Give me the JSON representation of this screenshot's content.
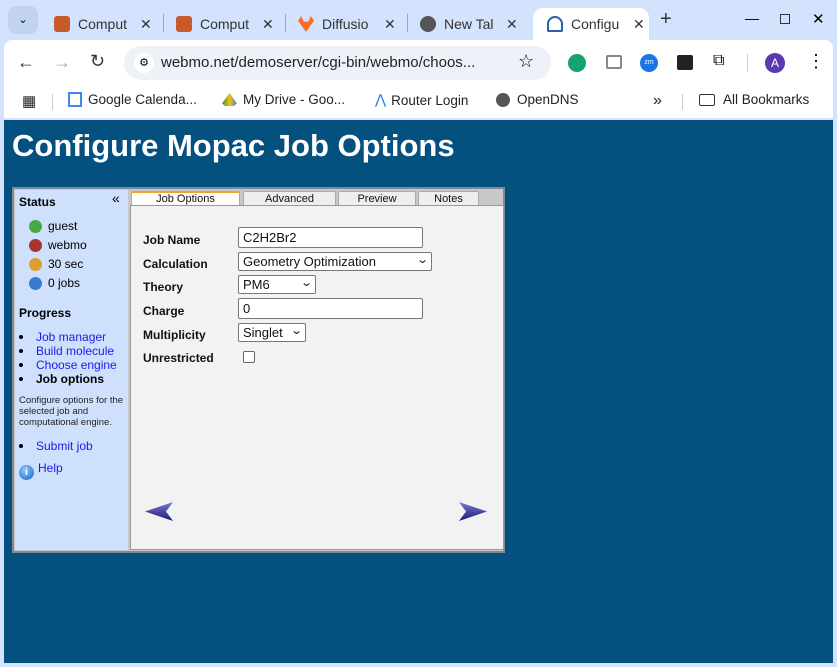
{
  "browser": {
    "tabs": [
      {
        "title": "Comput",
        "icon": "webmo-icon",
        "active": false
      },
      {
        "title": "Comput",
        "icon": "webmo-icon",
        "active": false
      },
      {
        "title": "Diffusio",
        "icon": "gitlab-icon",
        "active": false
      },
      {
        "title": "New Tal",
        "icon": "globe-icon",
        "active": false
      },
      {
        "title": "Configu",
        "icon": "webmo-logo-icon",
        "active": true
      }
    ],
    "url": "webmo.net/demoserver/cgi-bin/webmo/choos...",
    "profile_initial": "A",
    "bookmarks": [
      "Google Calenda...",
      "My Drive - Goo...",
      "Router Login",
      "OpenDNS"
    ],
    "all_bookmarks": "All Bookmarks"
  },
  "page": {
    "title": "Configure Mopac Job Options",
    "sidebar": {
      "status_heading": "Status",
      "status": [
        "guest",
        "webmo",
        "30 sec",
        "0 jobs"
      ],
      "progress_heading": "Progress",
      "progress": [
        {
          "label": "Job manager",
          "link": true
        },
        {
          "label": "Build molecule",
          "link": true
        },
        {
          "label": "Choose engine",
          "link": true
        },
        {
          "label": "Job options",
          "link": false
        }
      ],
      "description": "Configure options for the selected job and computational engine.",
      "submit": "Submit job",
      "help": "Help"
    },
    "tabs": [
      "Job Options",
      "Advanced",
      "Preview",
      "Notes"
    ],
    "form": {
      "job_name_label": "Job Name",
      "job_name": "C2H2Br2",
      "calculation_label": "Calculation",
      "calculation": "Geometry Optimization",
      "theory_label": "Theory",
      "theory": "PM6",
      "charge_label": "Charge",
      "charge": "0",
      "multiplicity_label": "Multiplicity",
      "multiplicity": "Singlet",
      "unrestricted_label": "Unrestricted",
      "unrestricted": false
    },
    "colors": {
      "background": "#04507f",
      "sidebar": "#cfe0fc",
      "link": "#1a1aee"
    }
  }
}
